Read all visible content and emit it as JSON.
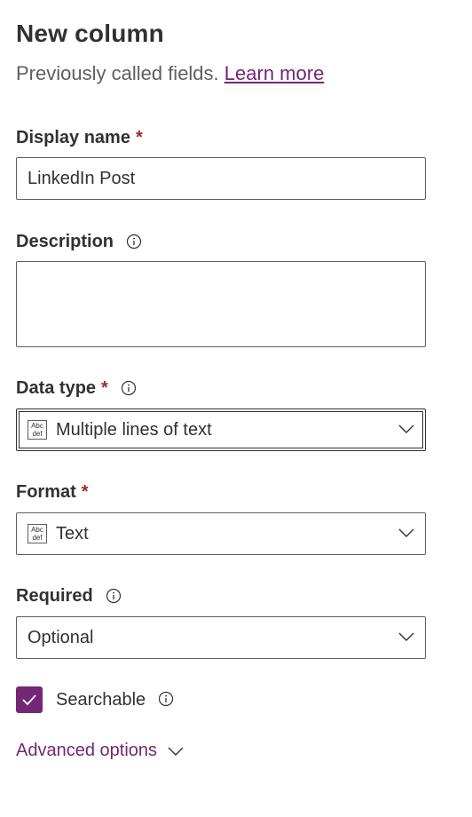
{
  "header": {
    "title": "New column",
    "subtitle": "Previously called fields.",
    "learn_more": "Learn more"
  },
  "display_name": {
    "label": "Display name",
    "required_mark": "*",
    "value": "LinkedIn Post"
  },
  "description": {
    "label": "Description",
    "value": ""
  },
  "data_type": {
    "label": "Data type",
    "required_mark": "*",
    "value": "Multiple lines of text",
    "icon": "abc-def-icon"
  },
  "format": {
    "label": "Format",
    "required_mark": "*",
    "value": "Text",
    "icon": "abc-def-icon"
  },
  "required": {
    "label": "Required",
    "value": "Optional"
  },
  "searchable": {
    "label": "Searchable",
    "checked": true
  },
  "advanced": {
    "label": "Advanced options"
  },
  "colors": {
    "accent": "#742774",
    "required_star": "#a4262c",
    "text": "#323130",
    "subtle_text": "#605e5c",
    "border": "#605e5c"
  }
}
